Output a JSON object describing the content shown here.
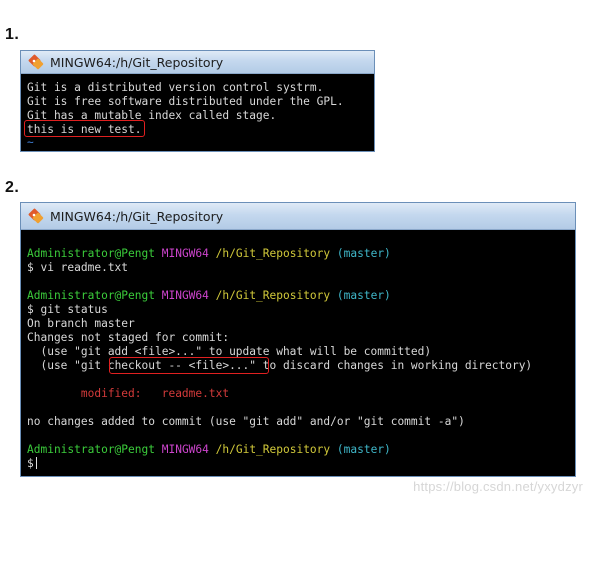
{
  "steps": {
    "first": {
      "number": "1."
    },
    "second": {
      "number": "2."
    }
  },
  "window1": {
    "title": "MINGW64:/h/Git_Repository",
    "icon": "git-bash-icon",
    "lines": [
      "Git is a distributed version control systrm.",
      "Git is free software distributed under the GPL.",
      "Git has a mutable index called stage.",
      "this is new test."
    ],
    "tilde": "~"
  },
  "window2": {
    "title": "MINGW64:/h/Git_Repository",
    "icon": "git-bash-icon",
    "prompt": {
      "user": "Administrator@Pengt",
      "system": "MINGW64",
      "path": "/h/Git_Repository",
      "branch": "(master)"
    },
    "commands": {
      "vi": "$ vi readme.txt",
      "status": "$ git status",
      "empty": "$"
    },
    "output": {
      "on_branch": "On branch master",
      "changes_header": "Changes not staged for commit:",
      "use_add_pre": "  (use \"git add <file>...\" to update what will be committed)",
      "use_checkout_pre": "  (use \"git ",
      "use_checkout_hl": "checkout -- <file>...\"",
      "use_checkout_post": " to discard changes in working directory)",
      "modified_label": "        modified:   ",
      "modified_file": "readme.txt",
      "no_changes": "no changes added to commit (use \"git add\" and/or \"git commit -a\")"
    }
  },
  "watermark": "https://blog.csdn.net/yxydzyr",
  "colors": {
    "prompt_user": "#3bcc3b",
    "prompt_system": "#cc44cc",
    "prompt_path": "#d1c93a",
    "prompt_branch": "#3fb7c9",
    "modified": "#d23a3a",
    "highlight_box": "#e02020"
  }
}
